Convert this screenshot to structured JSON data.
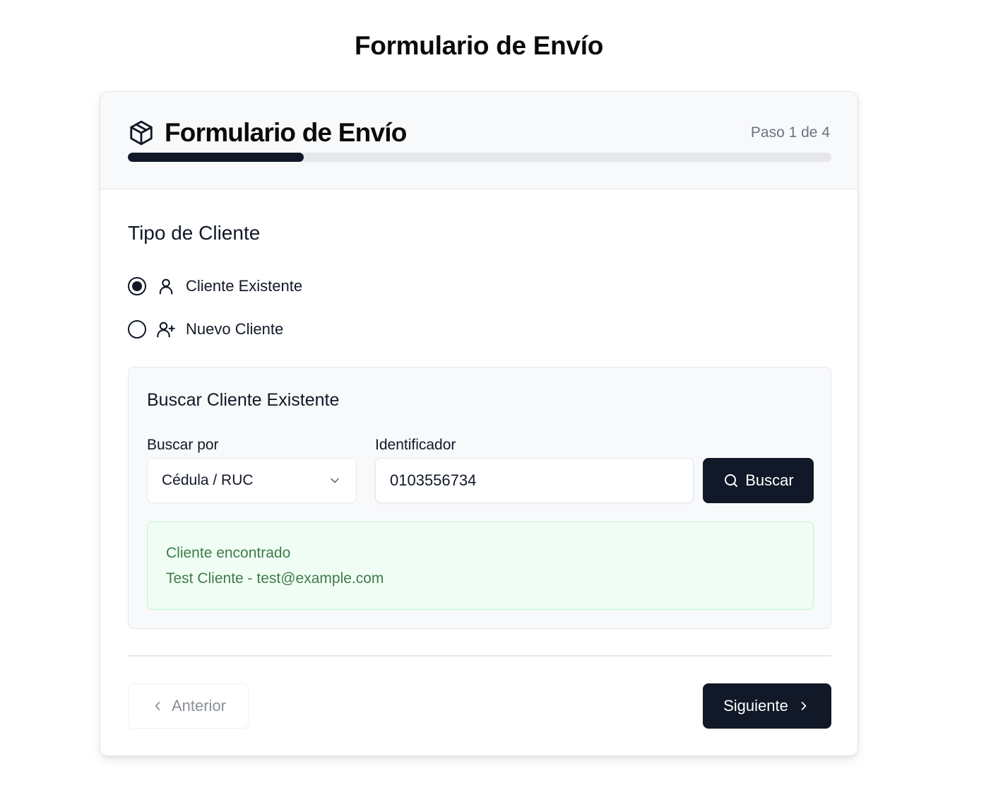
{
  "page": {
    "title": "Formulario de Envío"
  },
  "card": {
    "title": "Formulario de Envío",
    "icon": "package-box-icon",
    "step_text": "Paso 1 de 4",
    "progress": 0.25
  },
  "client_type": {
    "title": "Tipo de Cliente",
    "options": [
      {
        "label": "Cliente Existente",
        "icon": "user-icon",
        "selected": true
      },
      {
        "label": "Nuevo Cliente",
        "icon": "user-plus-icon",
        "selected": false
      }
    ]
  },
  "search": {
    "title": "Buscar Cliente Existente",
    "search_by_label": "Buscar por",
    "search_by_value": "Cédula / RUC",
    "identifier_label": "Identificador",
    "identifier_value": "0103556734",
    "button_label": "Buscar"
  },
  "result": {
    "title": "Cliente encontrado",
    "detail": "Test Cliente - test@example.com"
  },
  "navigation": {
    "prev_label": "Anterior",
    "next_label": "Siguiente"
  },
  "colors": {
    "primary": "#111827",
    "success_bg": "#f0fdf4",
    "success_text": "#3e7c4a",
    "muted": "#6b7280"
  }
}
